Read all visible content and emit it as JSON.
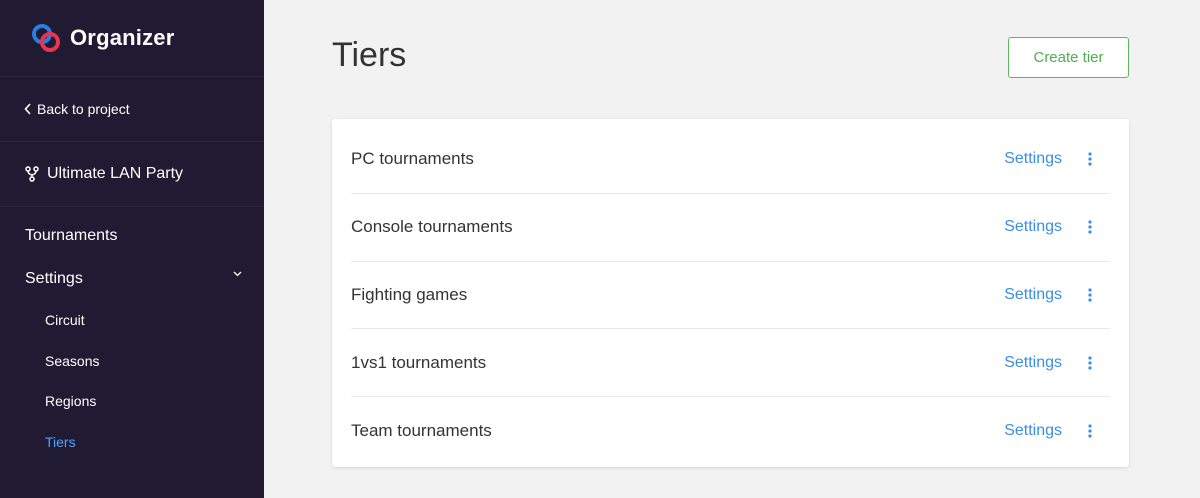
{
  "brand": {
    "name": "Organizer",
    "logo_icon": "organizer-logo-icon"
  },
  "sidebar": {
    "back_label": "Back to project",
    "project_name": "Ultimate LAN Party",
    "nav": [
      {
        "label": "Tournaments"
      },
      {
        "label": "Settings"
      }
    ],
    "settings_sub": [
      {
        "label": "Circuit"
      },
      {
        "label": "Seasons"
      },
      {
        "label": "Regions"
      },
      {
        "label": "Tiers"
      }
    ]
  },
  "page": {
    "title": "Tiers",
    "create_label": "Create tier"
  },
  "tiers": [
    {
      "name": "PC tournaments",
      "settings_label": "Settings"
    },
    {
      "name": "Console tournaments",
      "settings_label": "Settings"
    },
    {
      "name": "Fighting games",
      "settings_label": "Settings"
    },
    {
      "name": "1vs1 tournaments",
      "settings_label": "Settings"
    },
    {
      "name": "Team tournaments",
      "settings_label": "Settings"
    }
  ],
  "colors": {
    "sidebar_bg": "#211a33",
    "active_link": "#4fa3ff",
    "primary_button": "#4caf50",
    "settings_link": "#3a8ee6",
    "logo_blue": "#2a7de1",
    "logo_red": "#e8364f"
  }
}
